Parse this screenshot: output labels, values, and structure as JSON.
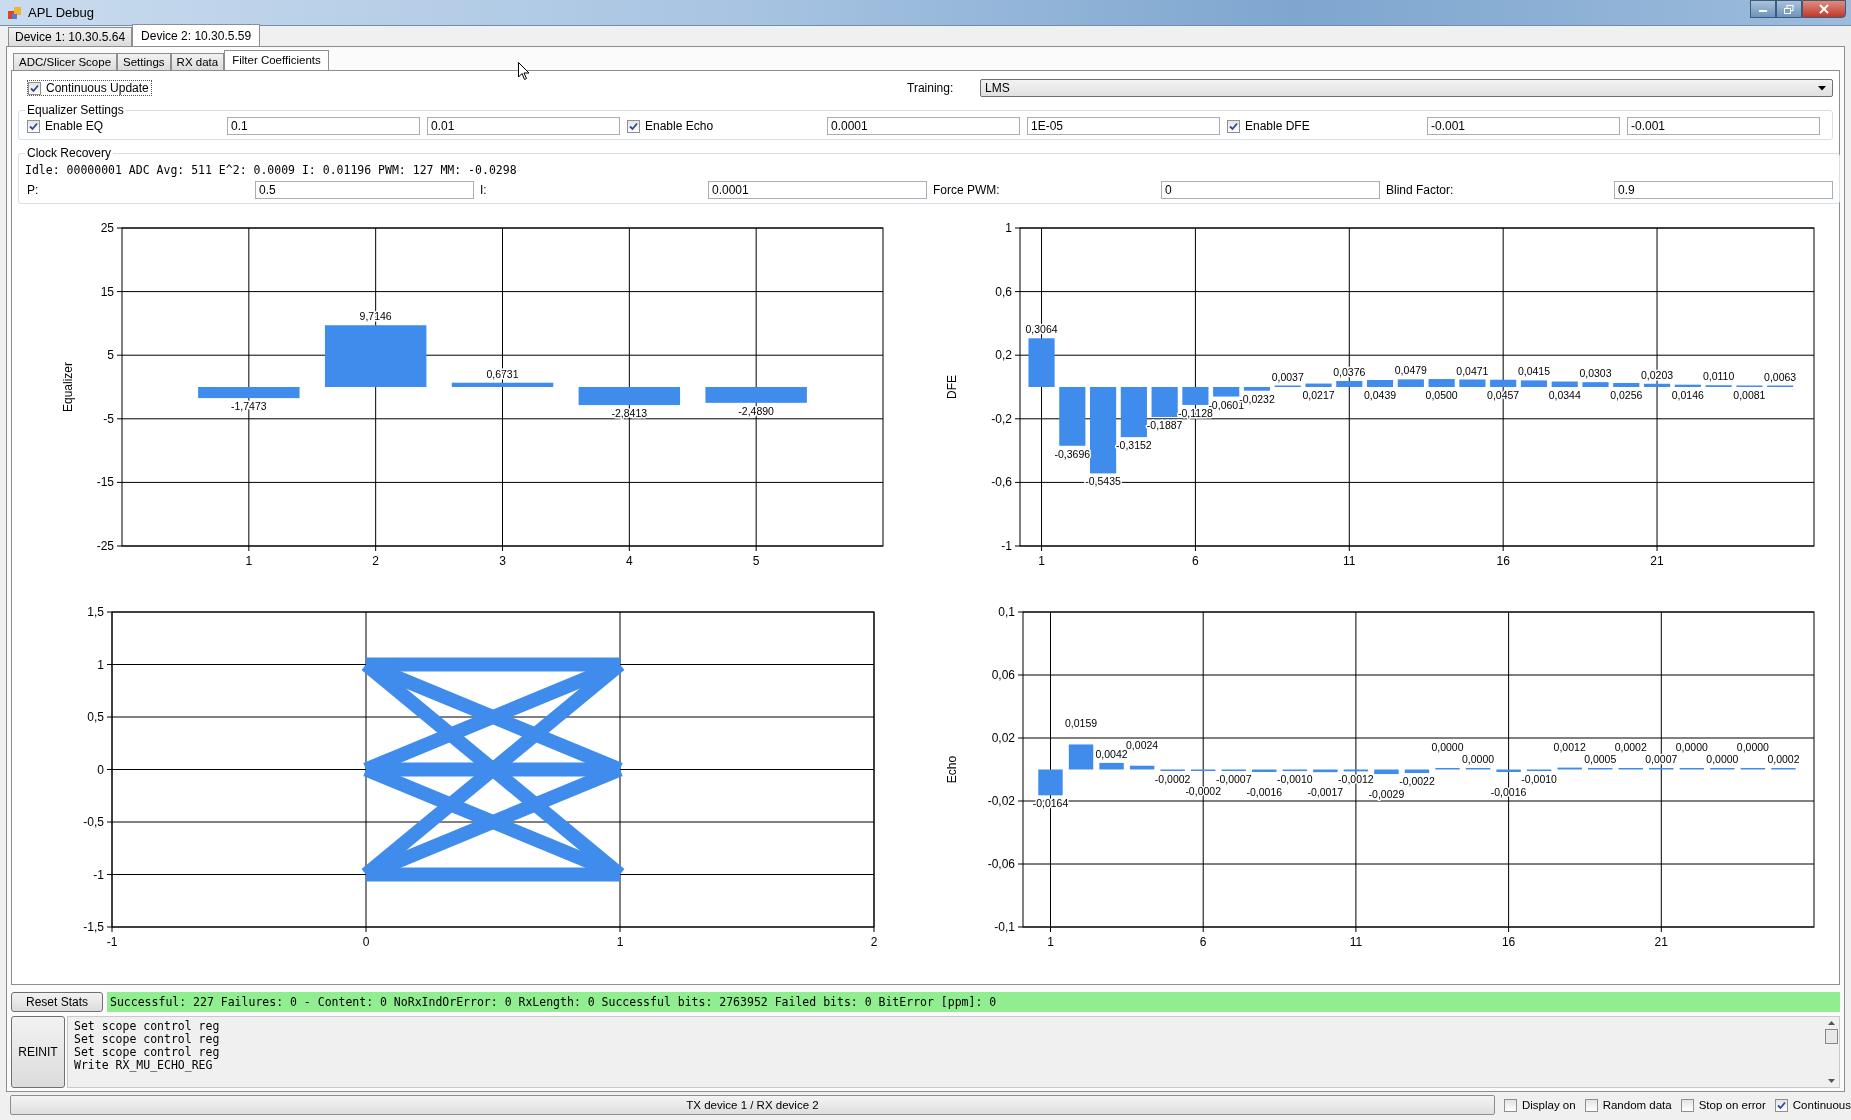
{
  "window": {
    "title": "APL Debug"
  },
  "device_tabs": [
    {
      "label": "Device 1: 10.30.5.64",
      "selected": false
    },
    {
      "label": "Device 2: 10.30.5.59",
      "selected": true
    }
  ],
  "tabs": [
    {
      "label": "ADC/Slicer Scope",
      "selected": false
    },
    {
      "label": "Settings",
      "selected": false
    },
    {
      "label": "RX data",
      "selected": false
    },
    {
      "label": "Filter Coefficients",
      "selected": true
    }
  ],
  "continuous_update": {
    "label": "Continuous Update",
    "checked": true
  },
  "training": {
    "label": "Training:",
    "value": "LMS"
  },
  "equalizer_settings": {
    "title": "Equalizer Settings",
    "items": [
      {
        "label": "Enable EQ",
        "checked": true,
        "values": [
          "0.1",
          "0.01"
        ]
      },
      {
        "label": "Enable Echo",
        "checked": true,
        "values": [
          "0.0001",
          "1E-05"
        ]
      },
      {
        "label": "Enable DFE",
        "checked": true,
        "values": [
          "-0.001",
          "-0.001"
        ]
      }
    ]
  },
  "clock_recovery": {
    "title": "Clock Recovery",
    "status": "Idle: 00000001 ADC Avg: 511 E^2: 0.0009 I: 0.01196 PWM: 127 MM: -0.0298",
    "fields": [
      {
        "label": "P:",
        "value": "0.5"
      },
      {
        "label": "I:",
        "value": "0.0001"
      },
      {
        "label": "Force PWM:",
        "value": "0"
      },
      {
        "label": "Blind Factor:",
        "value": "0.9"
      }
    ]
  },
  "charts": [
    {
      "chart_data": {
        "type": "bar",
        "grid": true,
        "ylabel": "Equalizer",
        "x": [
          1,
          2,
          3,
          4,
          5
        ],
        "values": [
          -1.7473,
          9.7146,
          0.6731,
          -2.8413,
          -2.489
        ],
        "xlim": [
          0,
          6
        ],
        "ylim": [
          -25,
          25
        ],
        "xticks": [
          1,
          2,
          3,
          4,
          5
        ],
        "yticks": [
          -25,
          -15,
          -5,
          5,
          15,
          25
        ],
        "value_labels": [
          "-1,7473",
          "9,7146",
          "0,6731",
          "-2,8413",
          "-2,4890"
        ]
      }
    },
    {
      "chart_data": {
        "type": "bar",
        "grid": true,
        "ylabel": "DFE",
        "x": [
          1,
          2,
          3,
          4,
          5,
          6,
          7,
          8,
          9,
          10,
          11,
          12,
          13,
          14,
          15,
          16,
          17,
          18,
          19,
          20,
          21,
          22,
          23,
          24,
          25
        ],
        "values": [
          0.3064,
          -0.3696,
          -0.5435,
          -0.3152,
          -0.1887,
          -0.1128,
          -0.0601,
          -0.0232,
          0.0037,
          0.0217,
          0.0376,
          0.0439,
          0.0479,
          0.05,
          0.0471,
          0.0457,
          0.0415,
          0.0344,
          0.0303,
          0.0256,
          0.0203,
          0.0146,
          0.011,
          0.0081,
          0.0063
        ],
        "xlim": [
          0.3,
          26.1
        ],
        "ylim": [
          -1,
          1
        ],
        "xticks": [
          1,
          6,
          11,
          16,
          21
        ],
        "yticks": [
          -1,
          {
            "value": -0.6,
            "label": "-0,6"
          },
          {
            "value": -0.2,
            "label": "-0,2"
          },
          {
            "value": 0.2,
            "label": "0,2"
          },
          {
            "value": 0.6,
            "label": "0,6"
          },
          1
        ],
        "value_labels": [
          "0,3064",
          "-0,3696",
          "-0,5435",
          "-0,3152",
          "-0,1887",
          "-0,1128",
          "-0,0601",
          "-0,0232",
          "0,0037",
          "0,0217",
          "0,0376",
          "0,0439",
          "0,0479",
          "0,0500",
          "0,0471",
          "0,0457",
          "0,0415",
          "0,0344",
          "0,0303",
          "0,0256",
          "0,0203",
          "0,0146",
          "0,0110",
          "0,0081",
          "0,0063"
        ]
      }
    },
    {
      "chart_data": {
        "type": "line",
        "grid": true,
        "x": [
          0,
          1
        ],
        "series": [
          {
            "values": [
              1,
              1
            ]
          },
          {
            "values": [
              1,
              0
            ]
          },
          {
            "values": [
              1,
              -1
            ]
          },
          {
            "values": [
              0,
              1
            ]
          },
          {
            "values": [
              0,
              0
            ]
          },
          {
            "values": [
              0,
              -1
            ]
          },
          {
            "values": [
              -1,
              1
            ]
          },
          {
            "values": [
              -1,
              0
            ]
          },
          {
            "values": [
              -1,
              -1
            ]
          }
        ],
        "xlim": [
          -1,
          2
        ],
        "ylim": [
          -1.5,
          1.5
        ],
        "xticks": [
          -1,
          0,
          1,
          2
        ],
        "yticks": [
          {
            "value": -1.5,
            "label": "-1,5"
          },
          -1,
          {
            "value": -0.5,
            "label": "-0,5"
          },
          0,
          {
            "value": 0.5,
            "label": "0,5"
          },
          1,
          {
            "value": 1.5,
            "label": "1,5"
          }
        ]
      }
    },
    {
      "chart_data": {
        "type": "bar",
        "grid": true,
        "ylabel": "Echo",
        "x": [
          1,
          2,
          3,
          4,
          5,
          6,
          7,
          8,
          9,
          10,
          11,
          12,
          13,
          14,
          15,
          16,
          17,
          18,
          19,
          20,
          21,
          22,
          23,
          24,
          25
        ],
        "values": [
          -0.0164,
          0.0159,
          0.0042,
          0.0024,
          -0.0002,
          -0.0002,
          -0.0007,
          -0.0016,
          -0.001,
          -0.0017,
          -0.0012,
          -0.0029,
          -0.0022,
          0,
          0,
          -0.0016,
          -0.001,
          0.0012,
          0.0005,
          0.0002,
          0.0007,
          0,
          0,
          0,
          0.0002
        ],
        "xlim": [
          0.1,
          26
        ],
        "ylim": [
          -0.1,
          0.1
        ],
        "xticks": [
          1,
          6,
          11,
          16,
          21
        ],
        "yticks": [
          {
            "value": -0.1,
            "label": "-0,1"
          },
          {
            "value": -0.06,
            "label": "-0,06"
          },
          {
            "value": -0.02,
            "label": "-0,02"
          },
          {
            "value": 0.02,
            "label": "0,02"
          },
          {
            "value": 0.06,
            "label": "0,06"
          },
          {
            "value": 0.1,
            "label": "0,1"
          }
        ],
        "value_labels": [
          "-0,0164",
          "0,0159",
          "0,0042",
          "0,0024",
          "-0,0002",
          "-0,0002",
          "-0,0007",
          "-0,0016",
          "-0,0010",
          "-0,0017",
          "-0,0012",
          "-0,0029",
          "-0,0022",
          "0,0000",
          "0,0000",
          "-0,0016",
          "-0,0010",
          "0,0012",
          "0,0005",
          "0,0002",
          "0,0007",
          "0,0000",
          "0,0000",
          "0,0000",
          "0,0002"
        ]
      }
    }
  ],
  "stats": {
    "button": "Reset Stats",
    "text": "Successful: 227 Failures: 0 - Content: 0 NoRxIndOrError: 0 RxLength: 0 Successful bits: 2763952 Failed bits: 0 BitError [ppm]: 0"
  },
  "log": {
    "button": "REINIT",
    "lines": [
      "Set scope control reg",
      "Set scope control reg",
      "Set scope control reg",
      "Write RX_MU_ECHO_REG"
    ]
  },
  "status_bar": {
    "text": "TX device 1 / RX device 2",
    "options": [
      {
        "label": "Display on",
        "checked": false
      },
      {
        "label": "Random data",
        "checked": false
      },
      {
        "label": "Stop on error",
        "checked": false
      },
      {
        "label": "Continuous",
        "checked": true
      }
    ]
  }
}
